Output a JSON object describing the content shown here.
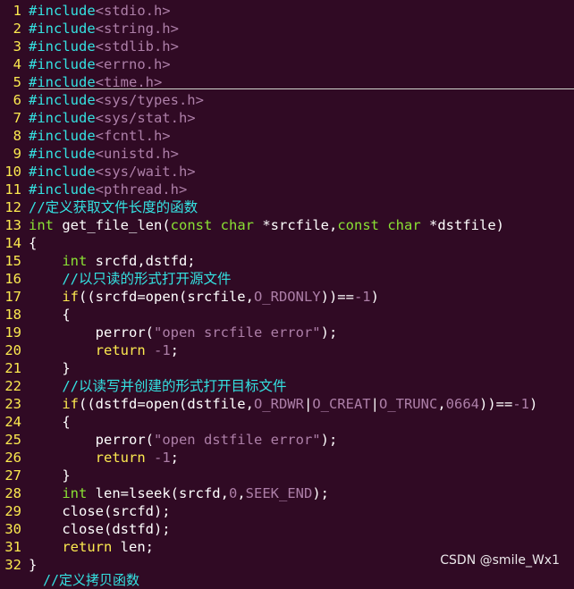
{
  "editor": {
    "lines": [
      {
        "n": "1",
        "tokens": [
          {
            "c": "pre",
            "t": "#include"
          },
          {
            "c": "inc",
            "t": "<stdio.h>"
          }
        ]
      },
      {
        "n": "2",
        "tokens": [
          {
            "c": "pre",
            "t": "#include"
          },
          {
            "c": "inc",
            "t": "<string.h>"
          }
        ]
      },
      {
        "n": "3",
        "tokens": [
          {
            "c": "pre",
            "t": "#include"
          },
          {
            "c": "inc",
            "t": "<stdlib.h>"
          }
        ]
      },
      {
        "n": "4",
        "tokens": [
          {
            "c": "pre",
            "t": "#include"
          },
          {
            "c": "inc",
            "t": "<errno.h>"
          }
        ]
      },
      {
        "n": "5",
        "tokens": [
          {
            "c": "pre",
            "t": "#include"
          },
          {
            "c": "inc",
            "t": "<time.h>"
          }
        ]
      },
      {
        "n": "6",
        "tokens": [
          {
            "c": "pre",
            "t": "#include"
          },
          {
            "c": "inc",
            "t": "<sys/types.h>"
          }
        ]
      },
      {
        "n": "7",
        "tokens": [
          {
            "c": "pre",
            "t": "#include"
          },
          {
            "c": "inc",
            "t": "<sys/stat.h>"
          }
        ]
      },
      {
        "n": "8",
        "tokens": [
          {
            "c": "pre",
            "t": "#include"
          },
          {
            "c": "inc",
            "t": "<fcntl.h>"
          }
        ]
      },
      {
        "n": "9",
        "tokens": [
          {
            "c": "pre",
            "t": "#include"
          },
          {
            "c": "inc",
            "t": "<unistd.h>"
          }
        ]
      },
      {
        "n": "10",
        "tokens": [
          {
            "c": "pre",
            "t": "#include"
          },
          {
            "c": "inc",
            "t": "<sys/wait.h>"
          }
        ]
      },
      {
        "n": "11",
        "tokens": [
          {
            "c": "pre",
            "t": "#include"
          },
          {
            "c": "inc",
            "t": "<pthread.h>"
          }
        ]
      },
      {
        "n": "12",
        "tokens": [
          {
            "c": "com",
            "t": "//定义获取文件长度的函数"
          }
        ]
      },
      {
        "n": "13",
        "tokens": [
          {
            "c": "typ",
            "t": "int"
          },
          {
            "c": "txt",
            "t": " get_file_len("
          },
          {
            "c": "typ",
            "t": "const"
          },
          {
            "c": "txt",
            "t": " "
          },
          {
            "c": "typ",
            "t": "char"
          },
          {
            "c": "txt",
            "t": " *srcfile,"
          },
          {
            "c": "typ",
            "t": "const"
          },
          {
            "c": "txt",
            "t": " "
          },
          {
            "c": "typ",
            "t": "char"
          },
          {
            "c": "txt",
            "t": " *dstfile)"
          }
        ]
      },
      {
        "n": "14",
        "tokens": [
          {
            "c": "txt",
            "t": "{"
          }
        ]
      },
      {
        "n": "15",
        "tokens": [
          {
            "c": "txt",
            "t": "    "
          },
          {
            "c": "typ",
            "t": "int"
          },
          {
            "c": "txt",
            "t": " srcfd,dstfd;"
          }
        ]
      },
      {
        "n": "16",
        "tokens": [
          {
            "c": "txt",
            "t": "    "
          },
          {
            "c": "com",
            "t": "//以只读的形式打开源文件"
          }
        ]
      },
      {
        "n": "17",
        "tokens": [
          {
            "c": "txt",
            "t": "    "
          },
          {
            "c": "kw",
            "t": "if"
          },
          {
            "c": "txt",
            "t": "((srcfd=open(srcfile,"
          },
          {
            "c": "con",
            "t": "O_RDONLY"
          },
          {
            "c": "txt",
            "t": "))=="
          },
          {
            "c": "num",
            "t": "-1"
          },
          {
            "c": "txt",
            "t": ")"
          }
        ]
      },
      {
        "n": "18",
        "tokens": [
          {
            "c": "txt",
            "t": "    {"
          }
        ]
      },
      {
        "n": "19",
        "tokens": [
          {
            "c": "txt",
            "t": "        perror("
          },
          {
            "c": "str",
            "t": "\"open srcfile error\""
          },
          {
            "c": "txt",
            "t": ");"
          }
        ]
      },
      {
        "n": "20",
        "tokens": [
          {
            "c": "txt",
            "t": "        "
          },
          {
            "c": "kw",
            "t": "return"
          },
          {
            "c": "txt",
            "t": " "
          },
          {
            "c": "num",
            "t": "-1"
          },
          {
            "c": "txt",
            "t": ";"
          }
        ]
      },
      {
        "n": "21",
        "tokens": [
          {
            "c": "txt",
            "t": "    }"
          }
        ]
      },
      {
        "n": "22",
        "tokens": [
          {
            "c": "txt",
            "t": "    "
          },
          {
            "c": "com",
            "t": "//以读写并创建的形式打开目标文件"
          }
        ]
      },
      {
        "n": "23",
        "tokens": [
          {
            "c": "txt",
            "t": "    "
          },
          {
            "c": "kw",
            "t": "if"
          },
          {
            "c": "txt",
            "t": "((dstfd=open(dstfile,"
          },
          {
            "c": "con",
            "t": "O_RDWR"
          },
          {
            "c": "txt",
            "t": "|"
          },
          {
            "c": "con",
            "t": "O_CREAT"
          },
          {
            "c": "txt",
            "t": "|"
          },
          {
            "c": "con",
            "t": "O_TRUNC"
          },
          {
            "c": "txt",
            "t": ","
          },
          {
            "c": "num",
            "t": "0664"
          },
          {
            "c": "txt",
            "t": "))=="
          },
          {
            "c": "num",
            "t": "-1"
          },
          {
            "c": "txt",
            "t": ")"
          }
        ]
      },
      {
        "n": "24",
        "tokens": [
          {
            "c": "txt",
            "t": "    {"
          }
        ]
      },
      {
        "n": "25",
        "tokens": [
          {
            "c": "txt",
            "t": "        perror("
          },
          {
            "c": "str",
            "t": "\"open dstfile error\""
          },
          {
            "c": "txt",
            "t": ");"
          }
        ]
      },
      {
        "n": "26",
        "tokens": [
          {
            "c": "txt",
            "t": "        "
          },
          {
            "c": "kw",
            "t": "return"
          },
          {
            "c": "txt",
            "t": " "
          },
          {
            "c": "num",
            "t": "-1"
          },
          {
            "c": "txt",
            "t": ";"
          }
        ]
      },
      {
        "n": "27",
        "tokens": [
          {
            "c": "txt",
            "t": "    }"
          }
        ]
      },
      {
        "n": "28",
        "tokens": [
          {
            "c": "txt",
            "t": "    "
          },
          {
            "c": "typ",
            "t": "int"
          },
          {
            "c": "txt",
            "t": " len=lseek(srcfd,"
          },
          {
            "c": "num",
            "t": "0"
          },
          {
            "c": "txt",
            "t": ","
          },
          {
            "c": "con",
            "t": "SEEK_END"
          },
          {
            "c": "txt",
            "t": ");"
          }
        ]
      },
      {
        "n": "29",
        "tokens": [
          {
            "c": "txt",
            "t": "    close(srcfd);"
          }
        ]
      },
      {
        "n": "30",
        "tokens": [
          {
            "c": "txt",
            "t": "    close(dstfd);"
          }
        ]
      },
      {
        "n": "31",
        "tokens": [
          {
            "c": "txt",
            "t": "    "
          },
          {
            "c": "kw",
            "t": "return"
          },
          {
            "c": "txt",
            "t": " len;"
          }
        ]
      },
      {
        "n": "32",
        "tokens": [
          {
            "c": "txt",
            "t": "}"
          }
        ]
      }
    ],
    "partial_line": "//定义拷贝函数"
  },
  "watermark": "CSDN @smile_Wx1",
  "colors": {
    "background": "#300a24",
    "line_number": "#fce94f",
    "preprocessor": "#34e2e2",
    "include_path": "#ad7fa8",
    "comment": "#34e2e2",
    "type": "#8ae234",
    "keyword": "#fce94f",
    "string": "#ad7fa8",
    "text": "#ffffff"
  }
}
